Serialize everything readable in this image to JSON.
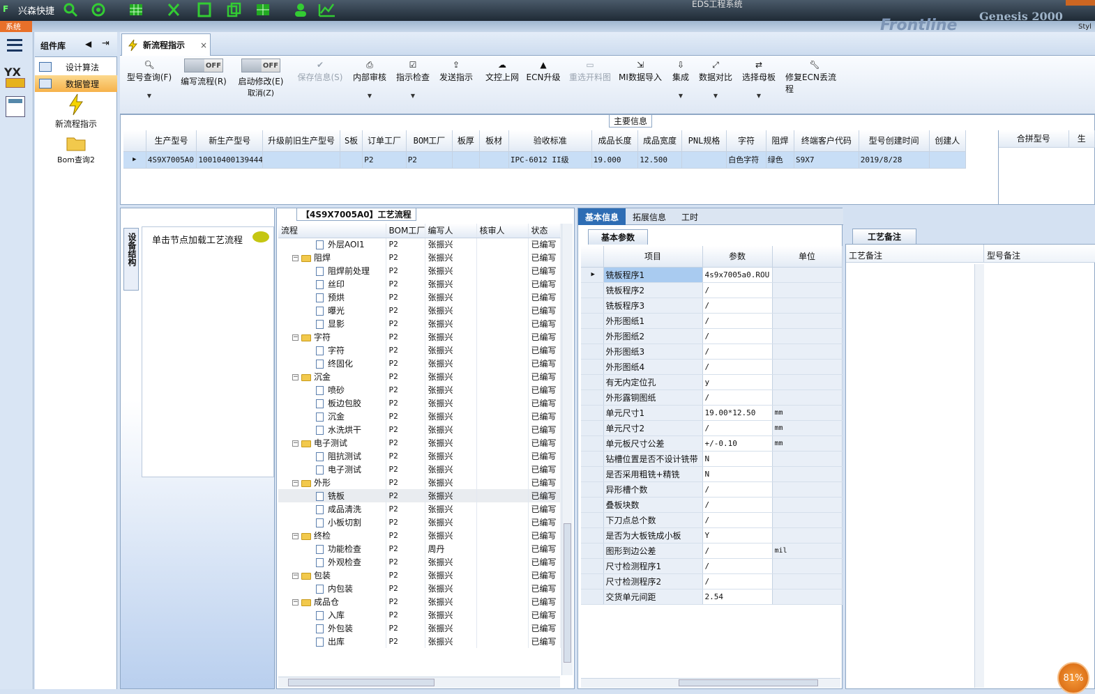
{
  "titlebar": {
    "quick": "兴森快捷",
    "title": "EDS工程系统",
    "brand": "Frontline",
    "brand2": "Genesis 2000",
    "style": "Styl",
    "system": "系统"
  },
  "sidebar": {
    "header": "组件库",
    "items": [
      "设计算法",
      "数据管理"
    ],
    "icons": [
      {
        "label": "新流程指示"
      },
      {
        "label": "Bom查询2"
      }
    ],
    "rail": "YX"
  },
  "tab": {
    "label": "新流程指示",
    "close": "×"
  },
  "toolbar": {
    "query": "型号查询(F)",
    "edit_flow": "编写流程(R)",
    "start_edit": "启动修改(E)",
    "cancel": "取消(Z)",
    "off": "OFF",
    "save": "保存信息(S)",
    "internal_review": "内部审核",
    "check": "指示检查",
    "send": "发送指示",
    "upload": "文控上网",
    "ecn": "ECN升级",
    "reselect": "重选开料图",
    "mi_import": "MI数据导入",
    "integrate": "集成",
    "compare": "数据对比",
    "select_master": "选择母板",
    "fix_ecn": "修复ECN丢流程"
  },
  "main_info": {
    "title": "主要信息",
    "columns": [
      "生产型号",
      "新生产型号",
      "升级前旧生产型号",
      "S板",
      "订单工厂",
      "BOM工厂",
      "板厚",
      "板材",
      "验收标准",
      "成品长度",
      "成品宽度",
      "PNL规格",
      "字符",
      "阻焊",
      "终端客户代码",
      "型号创建时间",
      "创建人"
    ],
    "row": [
      "4S9X7005A0",
      "10010400139444",
      "",
      "",
      "P2",
      "P2",
      "",
      "",
      "IPC-6012 II级",
      "19.000",
      "12.500",
      "",
      "白色字符",
      "绿色",
      "S9X7",
      "2019/8/28",
      ""
    ],
    "right_columns": [
      "合拼型号",
      "生"
    ]
  },
  "flow": {
    "title": "【4S9X7005A0】工艺流程",
    "left_tab": "设备结构",
    "hint": "单击节点加载工艺流程",
    "columns": [
      "流程",
      "BOM工厂",
      "编写人",
      "核审人",
      "状态"
    ],
    "rows": [
      {
        "name": "外层AOI1",
        "level": 2,
        "factory": "P2",
        "writer": "张振兴",
        "status": "已编写"
      },
      {
        "name": "阻焊",
        "level": 1,
        "factory": "P2",
        "writer": "张振兴",
        "status": "已编写"
      },
      {
        "name": "阻焊前处理",
        "level": 2,
        "factory": "P2",
        "writer": "张振兴",
        "status": "已编写"
      },
      {
        "name": "丝印",
        "level": 2,
        "factory": "P2",
        "writer": "张振兴",
        "status": "已编写"
      },
      {
        "name": "预烘",
        "level": 2,
        "factory": "P2",
        "writer": "张振兴",
        "status": "已编写"
      },
      {
        "name": "曝光",
        "level": 2,
        "factory": "P2",
        "writer": "张振兴",
        "status": "已编写"
      },
      {
        "name": "显影",
        "level": 2,
        "factory": "P2",
        "writer": "张振兴",
        "status": "已编写"
      },
      {
        "name": "字符",
        "level": 1,
        "factory": "P2",
        "writer": "张振兴",
        "status": "已编写"
      },
      {
        "name": "字符",
        "level": 2,
        "factory": "P2",
        "writer": "张振兴",
        "status": "已编写"
      },
      {
        "name": "终固化",
        "level": 2,
        "factory": "P2",
        "writer": "张振兴",
        "status": "已编写"
      },
      {
        "name": "沉金",
        "level": 1,
        "factory": "P2",
        "writer": "张振兴",
        "status": "已编写"
      },
      {
        "name": "喷砂",
        "level": 2,
        "factory": "P2",
        "writer": "张振兴",
        "status": "已编写"
      },
      {
        "name": "板边包胶",
        "level": 2,
        "factory": "P2",
        "writer": "张振兴",
        "status": "已编写"
      },
      {
        "name": "沉金",
        "level": 2,
        "factory": "P2",
        "writer": "张振兴",
        "status": "已编写"
      },
      {
        "name": "水洗烘干",
        "level": 2,
        "factory": "P2",
        "writer": "张振兴",
        "status": "已编写"
      },
      {
        "name": "电子测试",
        "level": 1,
        "factory": "P2",
        "writer": "张振兴",
        "status": "已编写"
      },
      {
        "name": "阻抗测试",
        "level": 2,
        "factory": "P2",
        "writer": "张振兴",
        "status": "已编写"
      },
      {
        "name": "电子测试",
        "level": 2,
        "factory": "P2",
        "writer": "张振兴",
        "status": "已编写"
      },
      {
        "name": "外形",
        "level": 1,
        "factory": "P2",
        "writer": "张振兴",
        "status": "已编写"
      },
      {
        "name": "铣板",
        "level": 2,
        "factory": "P2",
        "writer": "张振兴",
        "status": "已编写",
        "selected": true
      },
      {
        "name": "成品清洗",
        "level": 2,
        "factory": "P2",
        "writer": "张振兴",
        "status": "已编写"
      },
      {
        "name": "小板切割",
        "level": 2,
        "factory": "P2",
        "writer": "张振兴",
        "status": "已编写"
      },
      {
        "name": "终检",
        "level": 1,
        "factory": "P2",
        "writer": "张振兴",
        "status": "已编写"
      },
      {
        "name": "功能检查",
        "level": 2,
        "factory": "P2",
        "writer": "周丹",
        "status": "已编写"
      },
      {
        "name": "外观检查",
        "level": 2,
        "factory": "P2",
        "writer": "张振兴",
        "status": "已编写"
      },
      {
        "name": "包装",
        "level": 1,
        "factory": "P2",
        "writer": "张振兴",
        "status": "已编写"
      },
      {
        "name": "内包装",
        "level": 2,
        "factory": "P2",
        "writer": "张振兴",
        "status": "已编写"
      },
      {
        "name": "成品仓",
        "level": 1,
        "factory": "P2",
        "writer": "张振兴",
        "status": "已编写"
      },
      {
        "name": "入库",
        "level": 2,
        "factory": "P2",
        "writer": "张振兴",
        "status": "已编写"
      },
      {
        "name": "外包装",
        "level": 2,
        "factory": "P2",
        "writer": "张振兴",
        "status": "已编写"
      },
      {
        "name": "出库",
        "level": 2,
        "factory": "P2",
        "writer": "张振兴",
        "status": "已编写"
      }
    ]
  },
  "info": {
    "tabs": [
      "基本信息",
      "拓展信息",
      "工时"
    ],
    "subtab": "基本参数",
    "columns": [
      "项目",
      "参数",
      "单位"
    ],
    "rows": [
      [
        "铣板程序1",
        "4s9x7005a0.ROU",
        ""
      ],
      [
        "铣板程序2",
        "/",
        ""
      ],
      [
        "铣板程序3",
        "/",
        ""
      ],
      [
        "外形图纸1",
        "/",
        ""
      ],
      [
        "外形图纸2",
        "/",
        ""
      ],
      [
        "外形图纸3",
        "/",
        ""
      ],
      [
        "外形图纸4",
        "/",
        ""
      ],
      [
        "有无内定位孔",
        "y",
        ""
      ],
      [
        "外形露铜图纸",
        "/",
        ""
      ],
      [
        "单元尺寸1",
        "19.00*12.50",
        "mm"
      ],
      [
        "单元尺寸2",
        "/",
        "mm"
      ],
      [
        "单元板尺寸公差",
        "+/-0.10",
        "mm"
      ],
      [
        "钻槽位置是否不设计铣带",
        "N",
        ""
      ],
      [
        "是否采用粗铣+精铣",
        "N",
        ""
      ],
      [
        "异形槽个数",
        "/",
        ""
      ],
      [
        "叠板块数",
        "/",
        ""
      ],
      [
        "下刀点总个数",
        "/",
        ""
      ],
      [
        "是否为大板铣成小板",
        "Y",
        ""
      ],
      [
        "图形到边公差",
        "/",
        "mil"
      ],
      [
        "尺寸检测程序1",
        "/",
        ""
      ],
      [
        "尺寸检测程序2",
        "/",
        ""
      ],
      [
        "交货单元间距",
        "2.54",
        ""
      ]
    ]
  },
  "remarks": {
    "tab": "工艺备注",
    "col1": "工艺备注",
    "col2": "型号备注"
  },
  "badge": "81%"
}
